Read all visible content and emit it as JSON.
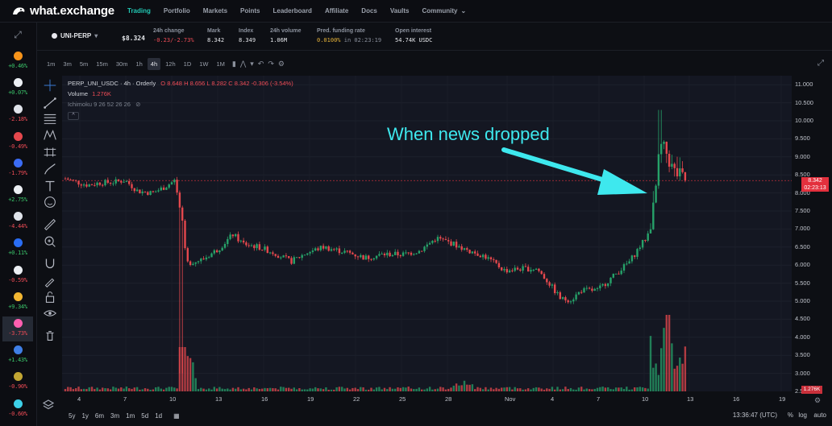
{
  "brand": {
    "name": "what.exchange"
  },
  "nav": {
    "items": [
      {
        "label": "Trading",
        "active": true
      },
      {
        "label": "Portfolio"
      },
      {
        "label": "Markets"
      },
      {
        "label": "Points"
      },
      {
        "label": "Leaderboard"
      },
      {
        "label": "Affiliate"
      },
      {
        "label": "Docs"
      },
      {
        "label": "Vaults"
      },
      {
        "label": "Community"
      }
    ]
  },
  "sidebar": {
    "items": [
      {
        "icon": "orange-coin-icon",
        "color": "#f7931a",
        "change": "+0.46%",
        "dir": "up"
      },
      {
        "icon": "eth-coin-icon",
        "color": "#eceff4",
        "change": "+0.07%",
        "dir": "up"
      },
      {
        "icon": "stack-coin-icon",
        "color": "#dfe3ea",
        "change": "-2.18%",
        "dir": "down"
      },
      {
        "icon": "red-coin-icon",
        "color": "#e5484d",
        "change": "-0.49%",
        "dir": "down"
      },
      {
        "icon": "hex-coin-icon",
        "color": "#3b6cf5",
        "change": "-1.79%",
        "dir": "down"
      },
      {
        "icon": "arrow-coin-icon",
        "color": "#eceff4",
        "change": "+2.75%",
        "dir": "up"
      },
      {
        "icon": "grid-coin-icon",
        "color": "#dfe3ea",
        "change": "-4.44%",
        "dir": "down"
      },
      {
        "icon": "blue-ring-coin-icon",
        "color": "#2a6df4",
        "change": "+0.11%",
        "dir": "up"
      },
      {
        "icon": "x-coin-icon",
        "color": "#eceff4",
        "change": "-0.59%",
        "dir": "down"
      },
      {
        "icon": "gold-coin-icon",
        "color": "#f2b632",
        "change": "+9.34%",
        "dir": "up"
      },
      {
        "icon": "uni-coin-icon",
        "color": "#ff5fb1",
        "change": "-3.73%",
        "dir": "down",
        "active": true
      },
      {
        "icon": "ltc-coin-icon",
        "color": "#3f7fe6",
        "change": "+1.43%",
        "dir": "up"
      },
      {
        "icon": "doge-coin-icon",
        "color": "#c2a633",
        "change": "-0.90%",
        "dir": "down"
      },
      {
        "icon": "bow-coin-icon",
        "color": "#3dd0e8",
        "change": "-0.60%",
        "dir": "down"
      }
    ]
  },
  "market": {
    "pair": "UNI-PERP",
    "price": "$8.324",
    "stats": [
      {
        "label": "24h change",
        "value": "-0.23/-2.73%",
        "tone": "down"
      },
      {
        "label": "Mark",
        "value": "8.342"
      },
      {
        "label": "Index",
        "value": "8.349"
      },
      {
        "label": "24h volume",
        "value": "1.06M"
      },
      {
        "label": "Pred. funding rate",
        "value": "0.0100%",
        "suffix": " in 02:23:19",
        "tone": "gold"
      },
      {
        "label": "Open interest",
        "value": "54.74K USDC"
      }
    ]
  },
  "toolbar": {
    "timeframes": [
      "1m",
      "3m",
      "5m",
      "15m",
      "30m",
      "1h",
      "4h",
      "12h",
      "1D",
      "1W",
      "1M"
    ],
    "active_timeframe": "4h"
  },
  "legend": {
    "symbol": "PERP_UNI_USDC · 4h · Orderly",
    "ohlc": "O 8.648  H 8.656  L 8.282  C 8.342  -0.306 (-3.54%)",
    "volume_label": "Volume",
    "volume_value": "1.276K",
    "ichimoku": "Ichimoku 9 26 52 26 26",
    "collapse": "^"
  },
  "price_axis": {
    "ticks": [
      "11.000",
      "10.500",
      "10.000",
      "9.500",
      "9.000",
      "8.500",
      "8.000",
      "7.500",
      "7.000",
      "6.500",
      "6.000",
      "5.500",
      "5.000",
      "4.500",
      "4.000",
      "3.500",
      "3.000",
      "2.500"
    ],
    "last_price": "8.342",
    "countdown": "02:23:13",
    "volume_tag": "1.276K"
  },
  "time_axis": {
    "ticks": [
      "4",
      "7",
      "10",
      "13",
      "16",
      "19",
      "22",
      "25",
      "28",
      "Nov",
      "4",
      "7",
      "10",
      "13",
      "16",
      "19"
    ]
  },
  "bottom": {
    "ranges": [
      "5y",
      "1y",
      "6m",
      "3m",
      "1m",
      "5d",
      "1d"
    ],
    "clock": "13:36:47 (UTC)",
    "percent": "%",
    "log": "log",
    "auto": "auto"
  },
  "annotation": {
    "text": "When news dropped"
  },
  "colors": {
    "up": "#26a269",
    "down": "#e5484d",
    "accent": "#22c8b4",
    "arrow": "#3ee8ee"
  },
  "chart_data": {
    "type": "candlestick",
    "interval": "4h",
    "ylim": [
      2.5,
      11.25
    ],
    "close_path": [
      {
        "x": "Oct 4",
        "y": 8.4
      },
      {
        "x": "Oct 5",
        "y": 8.2
      },
      {
        "x": "Oct 6",
        "y": 8.3
      },
      {
        "x": "Oct 7",
        "y": 8.35
      },
      {
        "x": "Oct 8",
        "y": 8.0
      },
      {
        "x": "Oct 9",
        "y": 8.15
      },
      {
        "x": "Oct 10",
        "y": 8.3
      },
      {
        "x": "Oct 10.5",
        "y": 6.0
      },
      {
        "x": "Oct 11",
        "y": 6.1
      },
      {
        "x": "Oct 13",
        "y": 6.7
      },
      {
        "x": "Oct 15",
        "y": 6.6
      },
      {
        "x": "Oct 17",
        "y": 6.2
      },
      {
        "x": "Oct 19",
        "y": 6.4
      },
      {
        "x": "Oct 21",
        "y": 6.2
      },
      {
        "x": "Oct 23",
        "y": 6.3
      },
      {
        "x": "Oct 25",
        "y": 6.35
      },
      {
        "x": "Oct 27",
        "y": 6.7
      },
      {
        "x": "Oct 29",
        "y": 6.4
      },
      {
        "x": "Oct 31",
        "y": 5.9
      },
      {
        "x": "Nov 2",
        "y": 5.85
      },
      {
        "x": "Nov 4",
        "y": 5.1
      },
      {
        "x": "Nov 5",
        "y": 5.3
      },
      {
        "x": "Nov 7",
        "y": 5.4
      },
      {
        "x": "Nov 8",
        "y": 6.0
      },
      {
        "x": "Nov 9",
        "y": 6.5
      },
      {
        "x": "Nov 10",
        "y": 7.0
      },
      {
        "x": "Nov 10.5",
        "y": 8.0
      },
      {
        "x": "Nov 11",
        "y": 9.3
      },
      {
        "x": "Nov 11.5",
        "y": 8.6
      },
      {
        "x": "Nov 12",
        "y": 8.342
      }
    ],
    "events": [
      {
        "x": "Oct 10.5",
        "low": 3.0
      },
      {
        "x": "Nov 11",
        "high": 10.3
      }
    ]
  }
}
